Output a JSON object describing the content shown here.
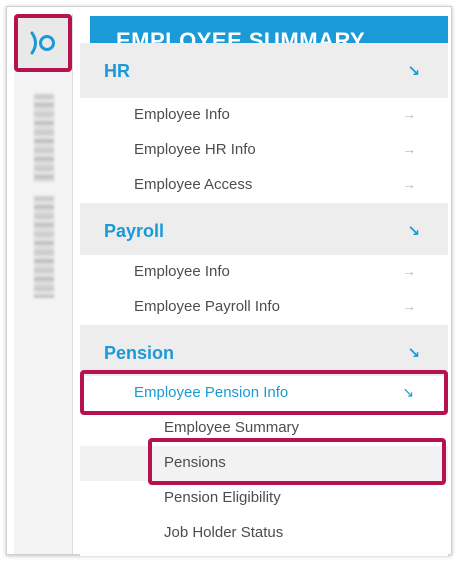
{
  "banner": {
    "title": "EMPLOYEE SUMMARY"
  },
  "colors": {
    "accent": "#1a9ad6",
    "highlight": "#b5124f",
    "text": "#4d4d4d"
  },
  "rail": {
    "logo_icon": "jo-logo-icon"
  },
  "sections": [
    {
      "title": "HR",
      "items": [
        {
          "label": "Employee Info"
        },
        {
          "label": "Employee HR Info"
        },
        {
          "label": "Employee Access"
        }
      ]
    },
    {
      "title": "Payroll",
      "items": [
        {
          "label": "Employee Info"
        },
        {
          "label": "Employee Payroll Info"
        }
      ]
    },
    {
      "title": "Pension",
      "items": [
        {
          "label": "Employee Pension Info",
          "expanded": true,
          "children": [
            {
              "label": "Employee Summary"
            },
            {
              "label": "Pensions"
            },
            {
              "label": "Pension Eligibility"
            },
            {
              "label": "Job Holder Status"
            }
          ]
        }
      ]
    }
  ],
  "icons": {
    "expand": "↘",
    "go": "→"
  }
}
